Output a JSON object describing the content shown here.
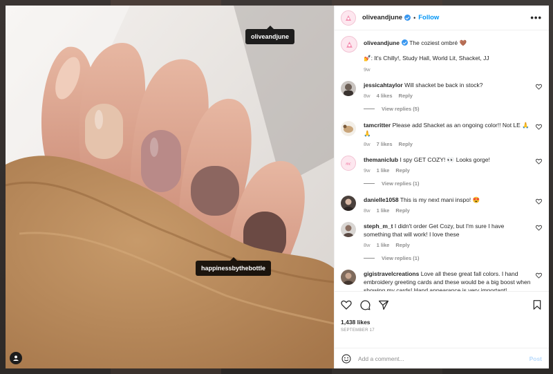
{
  "post": {
    "author": "oliveandjune",
    "follow_label": "Follow",
    "more_label": "•••",
    "separator": "•"
  },
  "photo_tags": [
    "oliveandjune",
    "happinessbythebottle"
  ],
  "caption": {
    "username": "oliveandjune",
    "line1": "The coziest ombré 🤎",
    "line2": "💅: It's Chilly!, Study Hall, World Lit, Shacket, JJ",
    "time": "9w"
  },
  "comments": [
    {
      "username": "jessicahtaylor",
      "text": "Will shacket be back in stock?",
      "time": "8w",
      "likes": "4 likes",
      "reply": "Reply",
      "view_replies": "View replies (5)"
    },
    {
      "username": "tamcritter",
      "text": "Please add Shacket as an ongoing color!! Not LE 🙏🙏",
      "time": "8w",
      "likes": "7 likes",
      "reply": "Reply",
      "view_replies": ""
    },
    {
      "username": "themaniclub",
      "text": "I spy GET COZY! 👀 Looks gorge!",
      "time": "9w",
      "likes": "1 like",
      "reply": "Reply",
      "view_replies": "View replies (1)"
    },
    {
      "username": "danielle1058",
      "text": "This is my next mani inspo! 😍",
      "time": "8w",
      "likes": "1 like",
      "reply": "Reply",
      "view_replies": ""
    },
    {
      "username": "steph_m_t",
      "text": "I didn't order Get Cozy, but I'm sure I have something that will work! I love these",
      "time": "8w",
      "likes": "1 like",
      "reply": "Reply",
      "view_replies": "View replies (1)"
    },
    {
      "username": "gigistravelcreations",
      "text": "Love all these great fall colors. I hand embroidery greeting cards and these would be a big boost when showing my cards! Hand appearance is very important!",
      "time": "",
      "likes": "",
      "reply": "",
      "view_replies": ""
    }
  ],
  "stats": {
    "likes": "1,438 likes",
    "date": "SEPTEMBER 17"
  },
  "composer": {
    "placeholder": "Add a comment...",
    "post_label": "Post"
  },
  "icons": [
    "heart-icon",
    "comment-icon",
    "share-icon",
    "bookmark-icon",
    "emoji-icon",
    "user-tag-icon",
    "more-icon",
    "verified-icon"
  ],
  "colors": {
    "accent": "#0095f6",
    "verified": "#3897f0",
    "text": "#262626",
    "muted": "#8e8e8e"
  }
}
